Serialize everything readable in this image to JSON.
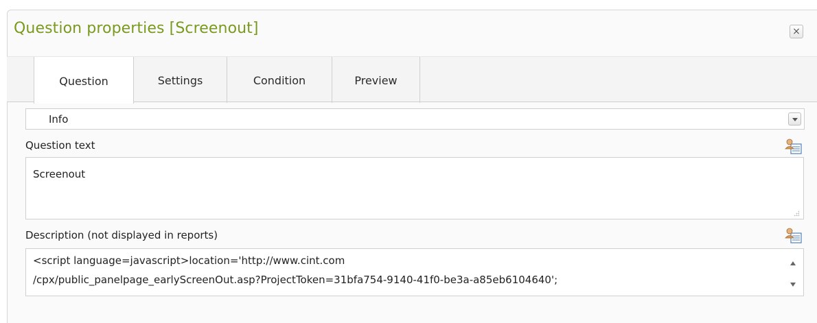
{
  "dialog": {
    "title": "Question properties [Screenout]",
    "close_label": "×"
  },
  "tabs": [
    {
      "label": "Question",
      "active": true
    },
    {
      "label": "Settings",
      "active": false
    },
    {
      "label": "Condition",
      "active": false
    },
    {
      "label": "Preview",
      "active": false
    }
  ],
  "question_type": {
    "selected": "Info"
  },
  "question_text": {
    "label": "Question text",
    "value": "Screenout"
  },
  "description": {
    "label": "Description (not displayed in reports)",
    "line1": "<script language=javascript>location='http://www.cint.com",
    "line2": "/cpx/public_panelpage_earlyScreenOut.asp?ProjectToken=31bfa754-9140-41f0-be3a-a85eb6104640';"
  },
  "colors": {
    "title": "#7a9a1e",
    "border": "#cfcfcf",
    "tab_bar": "#f4f4f4"
  },
  "icons": [
    "close-icon",
    "dropdown-arrow-icon",
    "text-editor-icon",
    "resize-grip-icon",
    "scroll-up-icon",
    "scroll-down-icon"
  ]
}
